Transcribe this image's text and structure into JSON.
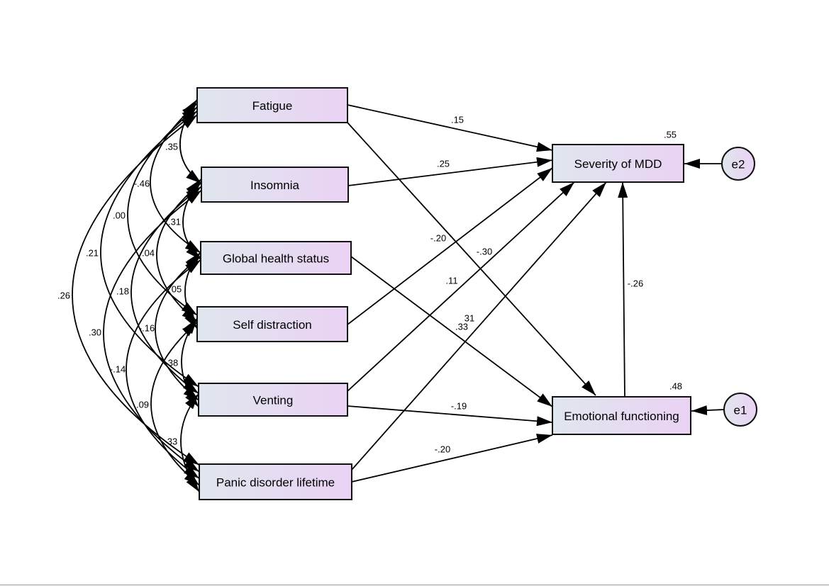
{
  "colors": {
    "box_fill_left": "#e0e6ee",
    "box_fill_right": "#ead2f4",
    "stroke": "#000000"
  },
  "predictors": [
    "Fatigue",
    "Insomnia",
    "Global health status",
    "Self distraction",
    "Venting",
    "Panic disorder lifetime"
  ],
  "outcomes": {
    "severity": "Severity of MDD",
    "emotional": "Emotional functioning"
  },
  "errors": {
    "e1": "e1",
    "e2": "e2"
  },
  "r_squared": {
    "severity": ".55",
    "emotional": ".48"
  },
  "paths": [
    {
      "from": "Fatigue",
      "to": "Severity of MDD",
      "coef": ".15"
    },
    {
      "from": "Fatigue",
      "to": "Emotional functioning",
      "coef": "-.30"
    },
    {
      "from": "Insomnia",
      "to": "Severity of MDD",
      "coef": ".25"
    },
    {
      "from": "Global health status",
      "to": "Emotional functioning",
      "coef": ".33"
    },
    {
      "from": "Self distraction",
      "to": "Severity of MDD",
      "coef": "-.20"
    },
    {
      "from": "Venting",
      "to": "Severity of MDD",
      "coef": ".11"
    },
    {
      "from": "Venting",
      "to": "Emotional functioning",
      "coef": "-.19"
    },
    {
      "from": "Panic disorder lifetime",
      "to": "Severity of MDD",
      "coef": "31"
    },
    {
      "from": "Panic disorder lifetime",
      "to": "Emotional functioning",
      "coef": "-.20"
    },
    {
      "from": "Emotional functioning",
      "to": "Severity of MDD",
      "coef": "-.26"
    }
  ],
  "covariances": [
    {
      "a": "Fatigue",
      "b": "Insomnia",
      "r": ".35"
    },
    {
      "a": "Fatigue",
      "b": "Global health status",
      "r": "-.46"
    },
    {
      "a": "Fatigue",
      "b": "Self distraction",
      "r": ".00"
    },
    {
      "a": "Fatigue",
      "b": "Venting",
      "r": ".21"
    },
    {
      "a": "Fatigue",
      "b": "Panic disorder lifetime",
      "r": ".26"
    },
    {
      "a": "Insomnia",
      "b": "Global health status",
      "r": ".31"
    },
    {
      "a": "Insomnia",
      "b": "Self distraction",
      "r": ".04"
    },
    {
      "a": "Insomnia",
      "b": "Venting",
      "r": ".18"
    },
    {
      "a": "Insomnia",
      "b": "Panic disorder lifetime",
      "r": ".30"
    },
    {
      "a": "Global health status",
      "b": "Self distraction",
      "r": "05"
    },
    {
      "a": "Global health status",
      "b": "Venting",
      "r": "-.16"
    },
    {
      "a": "Global health status",
      "b": "Panic disorder lifetime",
      "r": "-.14"
    },
    {
      "a": "Self distraction",
      "b": "Venting",
      "r": "38"
    },
    {
      "a": "Self distraction",
      "b": "Panic disorder lifetime",
      "r": ".09"
    },
    {
      "a": "Venting",
      "b": "Panic disorder lifetime",
      "r": "33"
    }
  ]
}
